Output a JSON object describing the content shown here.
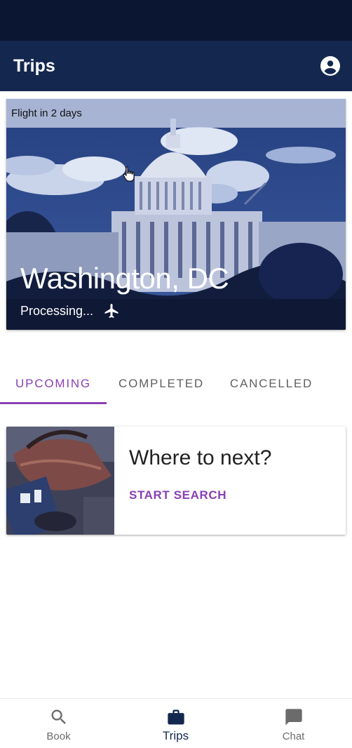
{
  "app_bar": {
    "title": "Trips"
  },
  "hero": {
    "banner": "Flight in 2 days",
    "city": "Washington, DC",
    "status": "Processing..."
  },
  "tabs": [
    {
      "label": "UPCOMING",
      "active": true
    },
    {
      "label": "COMPLETED",
      "active": false
    },
    {
      "label": "CANCELLED",
      "active": false
    }
  ],
  "next_card": {
    "title": "Where to next?",
    "action": "START SEARCH"
  },
  "bottom_nav": [
    {
      "label": "Book",
      "icon": "search-icon",
      "active": false
    },
    {
      "label": "Trips",
      "icon": "briefcase-icon",
      "active": true
    },
    {
      "label": "Chat",
      "icon": "chat-icon",
      "active": false
    }
  ],
  "colors": {
    "status_bar": "#0b1633",
    "app_bar": "#14284f",
    "accent": "#8a3fb3"
  }
}
